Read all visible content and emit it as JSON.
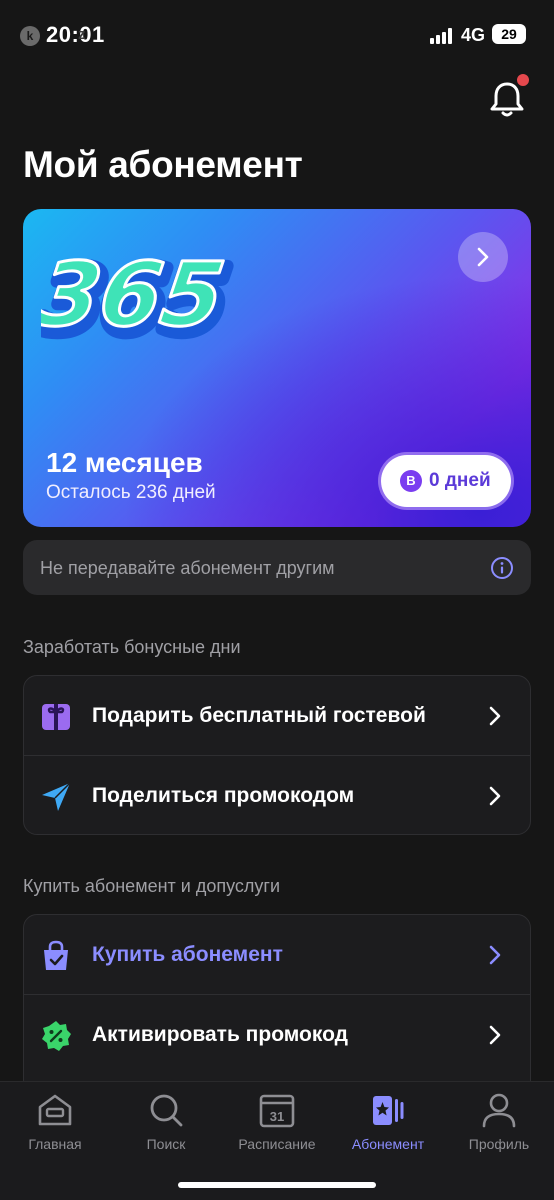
{
  "status_bar": {
    "logo": "k",
    "time": "20:01",
    "watermark": "z",
    "network": "4G",
    "battery": "29"
  },
  "header": {
    "title": "Мой абонемент",
    "notification_icon": "bell-icon",
    "has_notification_dot": true
  },
  "subscription": {
    "logo_text": "365",
    "period": "12 месяцев",
    "remaining": "Осталось 236 дней",
    "bonus_badge": "B",
    "bonus_days": "0 дней",
    "colors": {
      "gradient_start": "#1bb8f2",
      "gradient_end": "#6a25e0"
    }
  },
  "notice": {
    "text": "Не передавайте абонемент другим",
    "icon": "info-icon"
  },
  "bonus_section": {
    "title": "Заработать бонусные дни",
    "items": [
      {
        "label": "Подарить бесплатный гостевой",
        "icon": "gift-icon"
      },
      {
        "label": "Поделиться промокодом",
        "icon": "send-icon"
      }
    ]
  },
  "buy_section": {
    "title": "Купить абонемент и допуслуги",
    "items": [
      {
        "label": "Купить абонемент",
        "icon": "shopping-bag-icon"
      },
      {
        "label": "Активировать промокод",
        "icon": "promo-badge-icon"
      }
    ]
  },
  "tabbar": {
    "items": [
      {
        "label": "Главная",
        "icon": "home-icon"
      },
      {
        "label": "Поиск",
        "icon": "search-icon"
      },
      {
        "label": "Расписание",
        "icon": "calendar-icon",
        "calendar_day": "31"
      },
      {
        "label": "Абонемент",
        "icon": "membership-icon",
        "active": true
      },
      {
        "label": "Профиль",
        "icon": "profile-icon"
      }
    ]
  },
  "colors": {
    "background": "#161616",
    "accent": "#8b8dff",
    "card_surface": "#1c1c1e",
    "notification_dot": "#e5484d"
  }
}
